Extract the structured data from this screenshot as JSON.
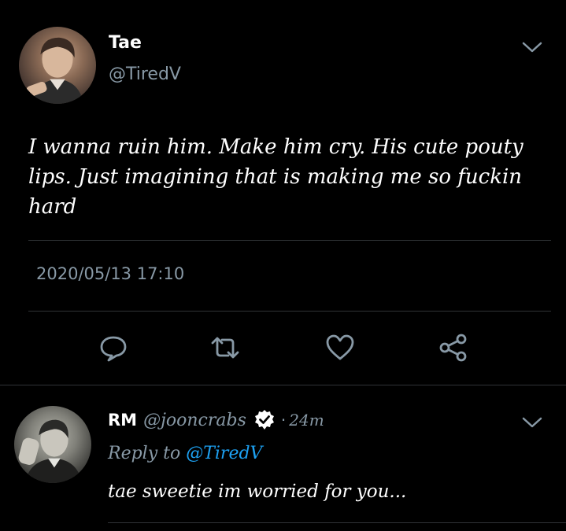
{
  "tweet": {
    "author_name": "Tae",
    "author_handle": "@TiredV",
    "text": "I wanna ruin him. Make him cry. His cute pouty lips. Just imagining that is making me so fuckin hard",
    "timestamp": "2020/05/13 17:10",
    "actions": [
      "reply-icon",
      "retweet-icon",
      "like-icon",
      "share-icon"
    ]
  },
  "reply": {
    "author_name": "RM",
    "author_handle": "@jooncrabs",
    "verified": true,
    "separator": "·",
    "time_ago": "24m",
    "replying_prefix": "Reply to",
    "replying_handle": "@TiredV",
    "text": "tae sweetie im worried for you..."
  },
  "colors": {
    "background": "#000000",
    "primary_text": "#ffffff",
    "secondary_text": "#8899a6",
    "accent": "#1da1f2",
    "divider": "#2f3336"
  }
}
